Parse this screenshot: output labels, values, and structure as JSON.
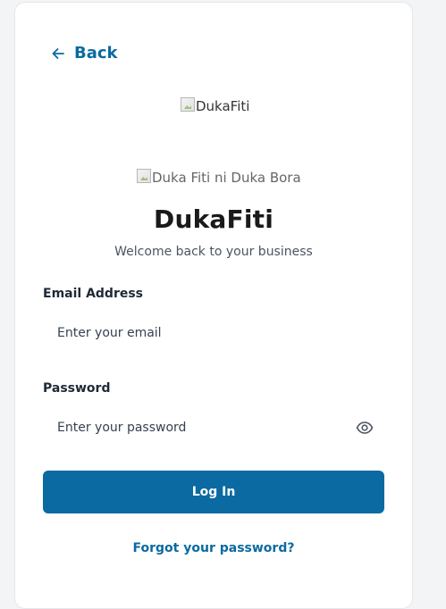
{
  "back": {
    "label": "Back"
  },
  "logo": {
    "alt": "DukaFiti"
  },
  "tagline_image": {
    "alt": "Duka Fiti ni Duka Bora"
  },
  "brand": {
    "title": "DukaFiti",
    "subtitle": "Welcome back to your business"
  },
  "form": {
    "email": {
      "label": "Email Address",
      "placeholder": "Enter your email",
      "value": ""
    },
    "password": {
      "label": "Password",
      "placeholder": "Enter your password",
      "value": ""
    },
    "login_label": "Log In",
    "forgot_label": "Forgot your password?"
  },
  "colors": {
    "accent": "#0a6aa1",
    "background": "#f3f4f6",
    "card": "#ffffff"
  },
  "icons": {
    "back": "arrow-left-icon",
    "password_toggle": "eye-icon",
    "broken_image": "broken-image-icon"
  }
}
